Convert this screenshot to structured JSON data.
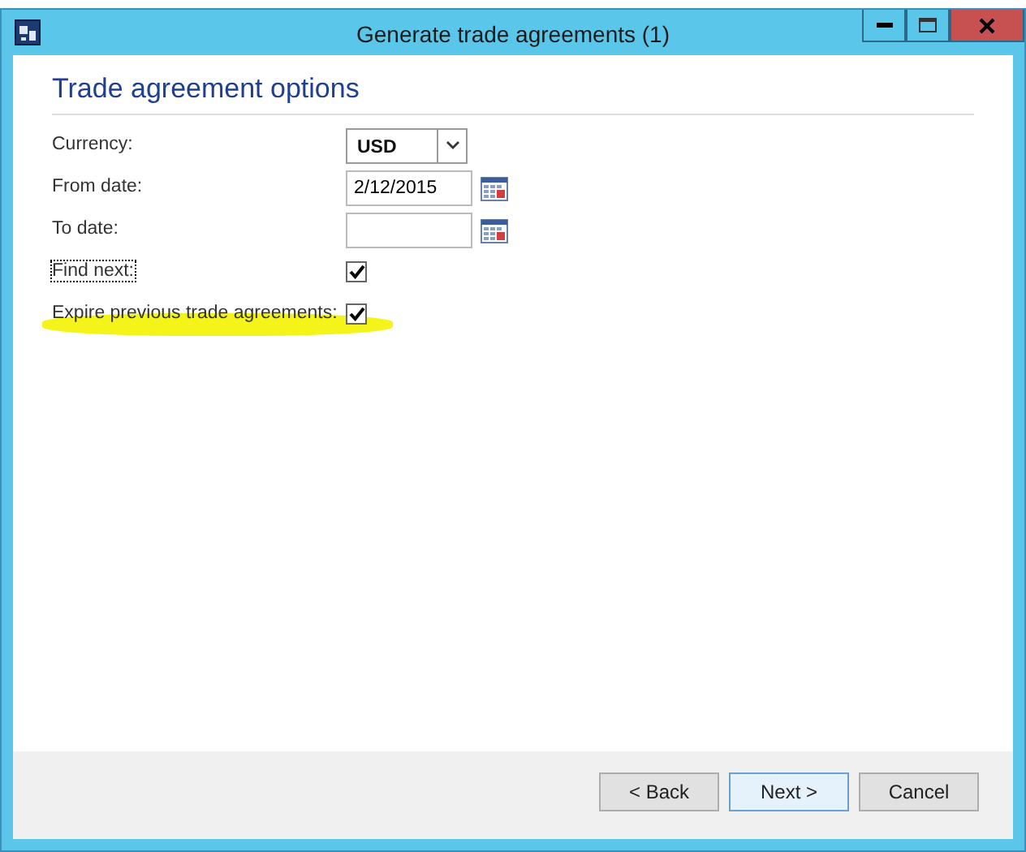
{
  "window": {
    "title": "Generate trade agreements (1)"
  },
  "section": {
    "title": "Trade agreement options"
  },
  "fields": [
    {
      "kind": "dropdown",
      "label": "Currency:",
      "value": "USD",
      "focused": false,
      "highlighted": false
    },
    {
      "kind": "date",
      "label": "From date:",
      "value": "2/12/2015",
      "focused": false,
      "highlighted": false
    },
    {
      "kind": "date",
      "label": "To date:",
      "focused": false,
      "highlighted": false
    },
    {
      "kind": "checkbox",
      "label": "Find next:",
      "checked": true,
      "focused": true,
      "highlighted": false
    },
    {
      "kind": "checkbox",
      "label": "Expire previous trade agreements:",
      "checked": true,
      "focused": false,
      "highlighted": true
    }
  ],
  "buttons": [
    {
      "label": "< Back",
      "default": false
    },
    {
      "label": "Next >",
      "default": true
    },
    {
      "label": "Cancel",
      "default": false
    }
  ]
}
